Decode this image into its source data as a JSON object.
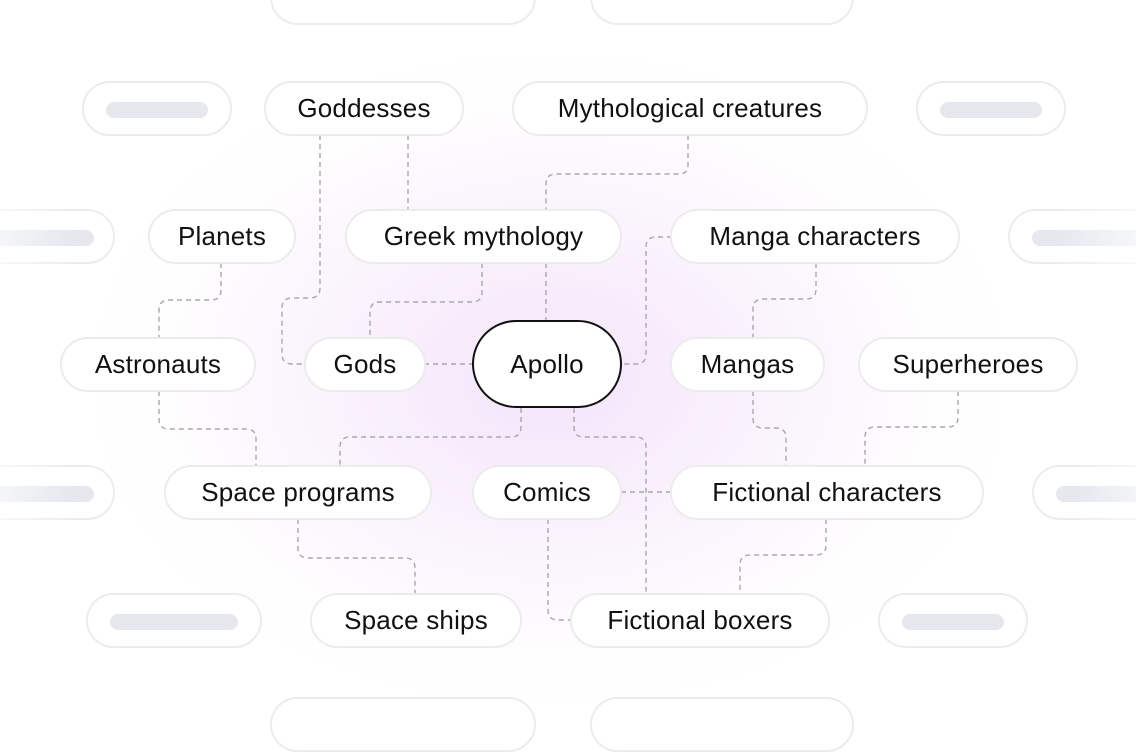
{
  "diagram": {
    "type": "mind-map",
    "center": {
      "id": "apollo",
      "label": "Apollo"
    },
    "nodes": [
      {
        "id": "goddesses",
        "label": "Goddesses"
      },
      {
        "id": "mythological-creatures",
        "label": "Mythological creatures"
      },
      {
        "id": "planets",
        "label": "Planets"
      },
      {
        "id": "greek-mythology",
        "label": "Greek mythology"
      },
      {
        "id": "manga-characters",
        "label": "Manga characters"
      },
      {
        "id": "astronauts",
        "label": "Astronauts"
      },
      {
        "id": "gods",
        "label": "Gods"
      },
      {
        "id": "mangas",
        "label": "Mangas"
      },
      {
        "id": "superheroes",
        "label": "Superheroes"
      },
      {
        "id": "space-programs",
        "label": "Space programs"
      },
      {
        "id": "comics",
        "label": "Comics"
      },
      {
        "id": "fictional-characters",
        "label": "Fictional characters"
      },
      {
        "id": "space-ships",
        "label": "Space ships"
      },
      {
        "id": "fictional-boxers",
        "label": "Fictional boxers"
      }
    ],
    "edges": [
      [
        "goddesses",
        "gods"
      ],
      [
        "goddesses",
        "greek-mythology"
      ],
      [
        "mythological-creatures",
        "greek-mythology"
      ],
      [
        "greek-mythology",
        "apollo"
      ],
      [
        "greek-mythology",
        "gods"
      ],
      [
        "gods",
        "apollo"
      ],
      [
        "planets",
        "astronauts"
      ],
      [
        "astronauts",
        "space-programs"
      ],
      [
        "apollo",
        "space-programs"
      ],
      [
        "space-programs",
        "space-ships"
      ],
      [
        "manga-characters",
        "apollo"
      ],
      [
        "manga-characters",
        "mangas"
      ],
      [
        "mangas",
        "fictional-characters"
      ],
      [
        "superheroes",
        "fictional-characters"
      ],
      [
        "comics",
        "fictional-characters"
      ],
      [
        "comics",
        "fictional-boxers"
      ],
      [
        "apollo",
        "fictional-boxers"
      ],
      [
        "fictional-characters",
        "fictional-boxers"
      ]
    ],
    "colors": {
      "center_border": "#111111",
      "node_border": "#ececec",
      "connector": "#a8a8ac",
      "placeholder_bar": "#e6e8ee",
      "glow": "#ecccf6"
    }
  }
}
